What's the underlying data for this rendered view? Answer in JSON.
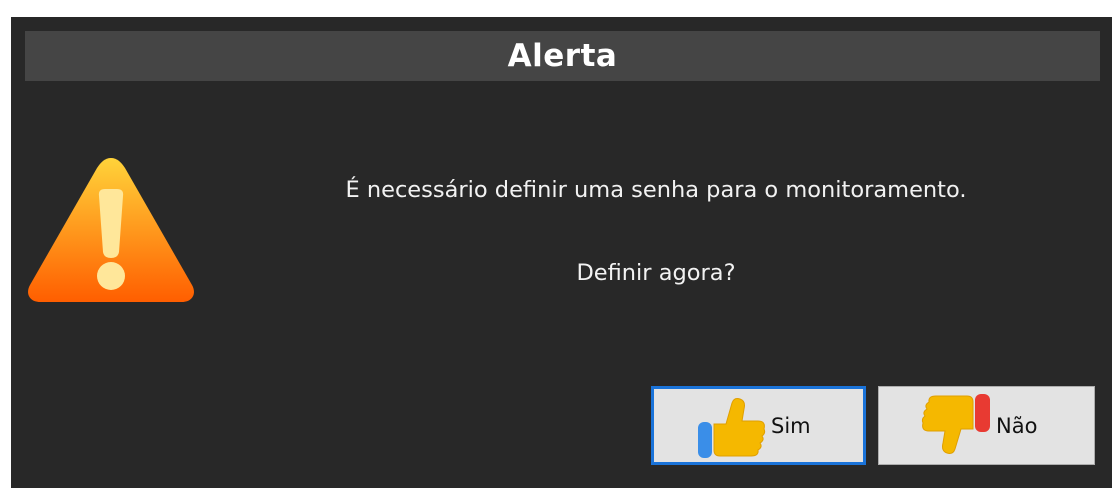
{
  "dialog": {
    "title": "Alerta",
    "icon": "warning-triangle-icon",
    "message_line_1": "É necessário definir uma senha para o monitoramento.",
    "message_line_2": "Definir agora?",
    "buttons": {
      "yes": {
        "label": "Sim",
        "icon": "thumbs-up-icon"
      },
      "no": {
        "label": "Não",
        "icon": "thumbs-down-icon"
      }
    }
  },
  "colors": {
    "dialog_background": "#282828",
    "title_bar": "#454545",
    "text": "#f2f2f2",
    "button_background": "#e3e3e3",
    "focus_border": "#1a73d9",
    "warning_top": "#ffd33a",
    "warning_bottom": "#ff5e00",
    "thumb_yellow": "#f5b800",
    "thumb_blue": "#3a8ee8",
    "thumb_red": "#e83a32"
  }
}
